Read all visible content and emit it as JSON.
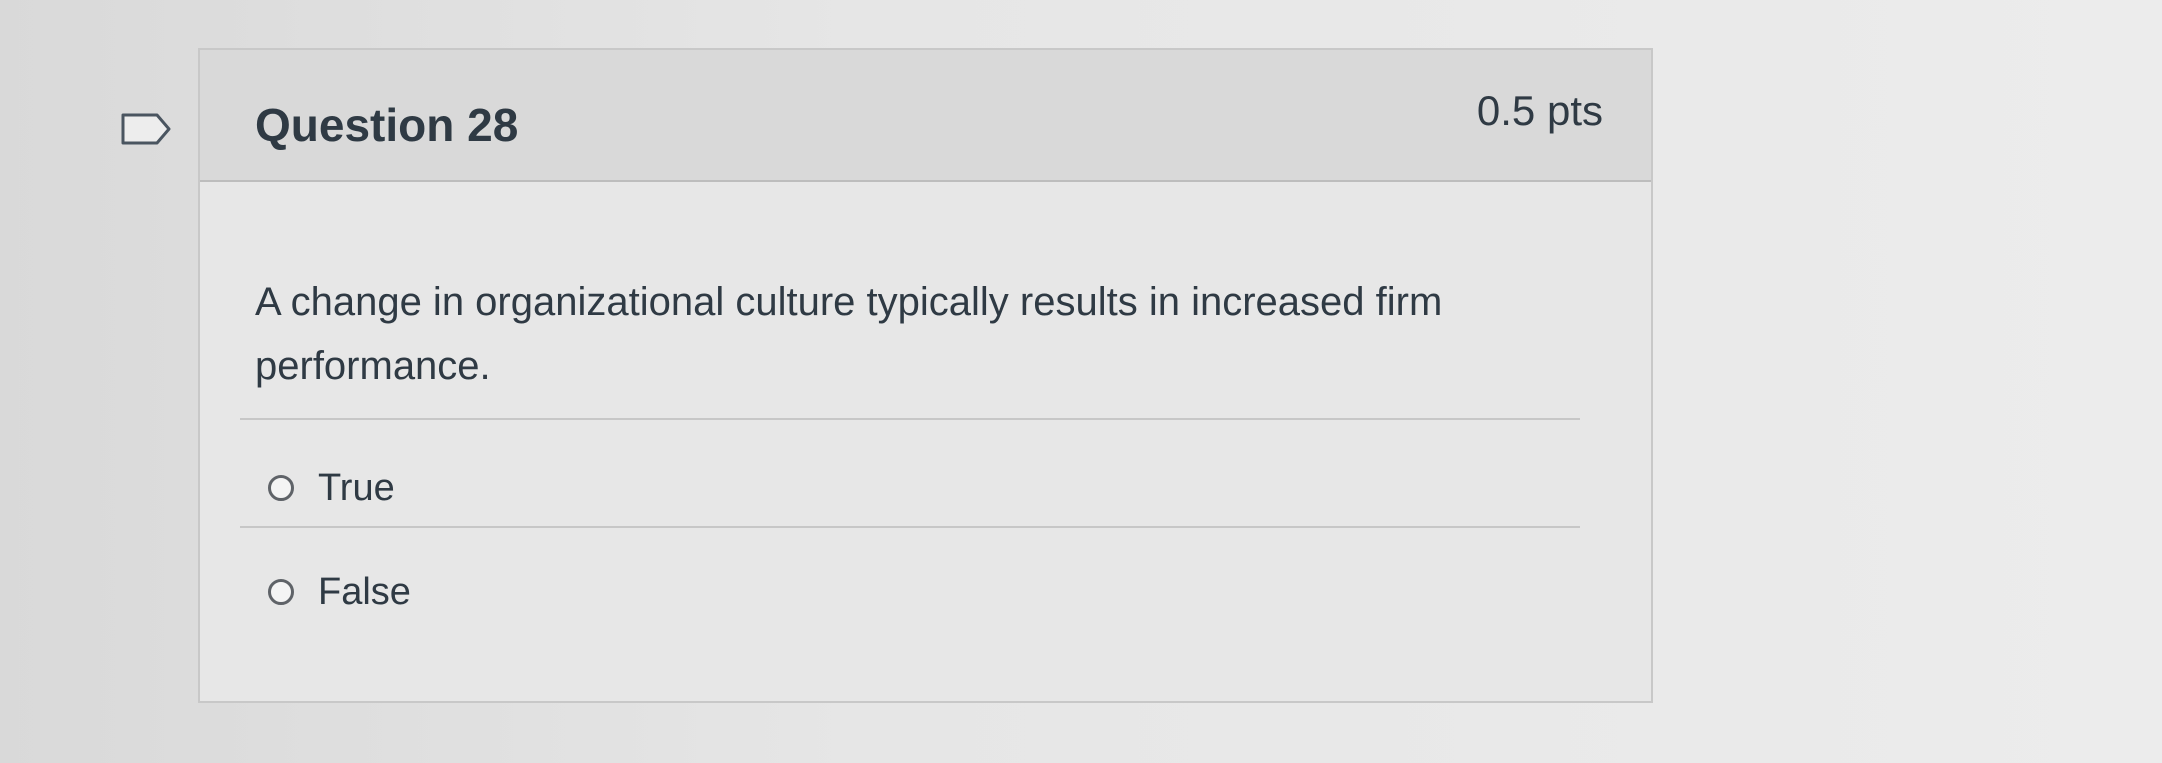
{
  "question": {
    "title": "Question 28",
    "points": "0.5 pts",
    "text": "A change in organizational culture typically results in increased firm performance.",
    "answers": [
      {
        "label": "True",
        "selected": false
      },
      {
        "label": "False",
        "selected": false
      }
    ]
  },
  "icons": {
    "flag": "flag-icon",
    "radio": "radio-icon"
  }
}
